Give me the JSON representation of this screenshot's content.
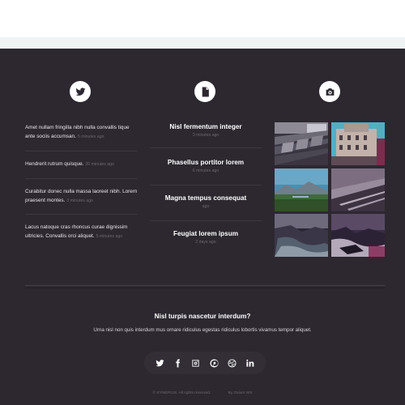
{
  "columns": {
    "twitter_icon": "twitter-icon",
    "posts_icon": "document-icon",
    "photos_icon": "camera-icon"
  },
  "tweets": [
    {
      "text": "Amet nullam fringilla nibh nulla convallis tique ante sociis accumsan.",
      "time": "5 minutes ago"
    },
    {
      "text": "Hendrerit rutrum quisque.",
      "time": "30 minutes ago"
    },
    {
      "text": "Curabitur donec nulla massa laoreet nibh. Lorem praesent montes.",
      "time": "3 minutes ago"
    },
    {
      "text": "Lacus natoque cras rhoncus curae dignissim ultricies. Convallis orci aliquet.",
      "time": "5 minutes ago"
    }
  ],
  "posts": [
    {
      "title": "Nisl fermentum integer",
      "time": "3 minutes ago"
    },
    {
      "title": "Phasellus portitor lorem",
      "time": "6 minutes ago"
    },
    {
      "title": "Magna tempus consequat",
      "time": "ago"
    },
    {
      "title": "Feugiat lorem ipsum",
      "time": "2 days ago"
    }
  ],
  "photos": [
    {
      "subject": "train-seats"
    },
    {
      "subject": "paris-building"
    },
    {
      "subject": "mountain-landscape"
    },
    {
      "subject": "station-platform"
    },
    {
      "subject": "coastal-cliffs"
    },
    {
      "subject": "misty-rocks"
    }
  ],
  "cta": {
    "title": "Nisl turpis nascetur interdum?",
    "text": "Urna nisl non quis interdum mus ornare ridiculus egestas ridiculus lobortis vivamus tempor aliquet."
  },
  "social": [
    "twitter-icon",
    "facebook-icon",
    "instagram-icon",
    "pinterest-icon",
    "dribbble-icon",
    "linkedin-icon"
  ],
  "footer": {
    "copyright": "© SYNERGIS. All rights reserved.",
    "credit": "By Oxium WS"
  },
  "colors": {
    "background": "#2d2830",
    "accent_white": "#ffffff",
    "muted_text": "#6d6670"
  }
}
